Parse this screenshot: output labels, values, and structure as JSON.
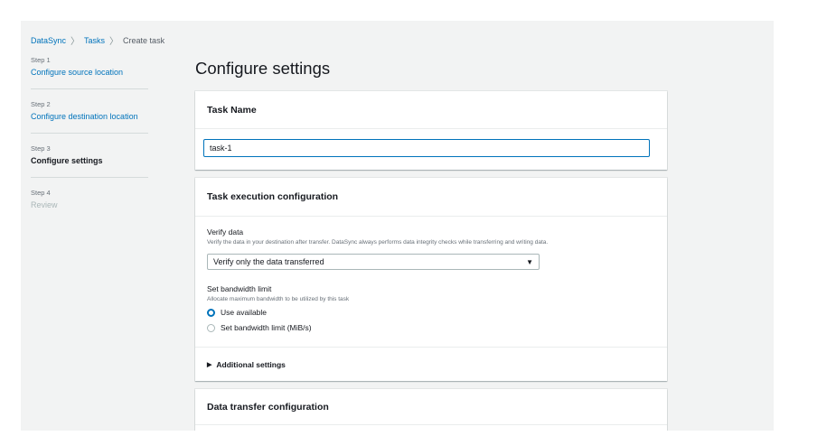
{
  "breadcrumb": {
    "items": [
      "DataSync",
      "Tasks"
    ],
    "current": "Create task"
  },
  "steps": [
    {
      "num": "Step 1",
      "label": "Configure source location",
      "state": "link"
    },
    {
      "num": "Step 2",
      "label": "Configure destination location",
      "state": "link"
    },
    {
      "num": "Step 3",
      "label": "Configure settings",
      "state": "active"
    },
    {
      "num": "Step 4",
      "label": "Review",
      "state": "disabled"
    }
  ],
  "page_title": "Configure settings",
  "task_name": {
    "title": "Task Name",
    "value": "task-1"
  },
  "execution": {
    "title": "Task execution configuration",
    "verify": {
      "label": "Verify data",
      "description": "Verify the data in your destination after transfer. DataSync always performs data integrity checks while transferring and writing data.",
      "selected": "Verify only the data transferred"
    },
    "bandwidth": {
      "label": "Set bandwidth limit",
      "description": "Allocate maximum bandwidth to be utilized by this task",
      "options": [
        "Use available",
        "Set bandwidth limit (MiB/s)"
      ],
      "selected_index": 0
    },
    "additional": "Additional settings"
  },
  "transfer": {
    "title": "Data transfer configuration"
  },
  "colors": {
    "link": "#0073bb",
    "background": "#f2f3f3",
    "text": "#16191f"
  }
}
